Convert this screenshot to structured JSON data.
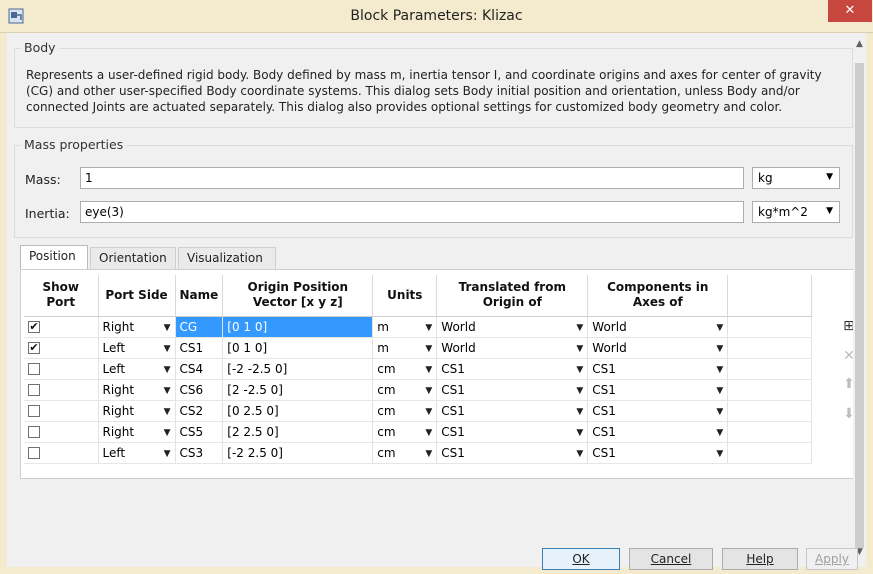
{
  "window": {
    "title": "Block Parameters: Klizac",
    "close_label": "✕"
  },
  "body_group": {
    "legend": "Body",
    "description": "Represents a user-defined rigid body. Body defined by mass m, inertia tensor I, and coordinate origins and axes for center of gravity (CG) and other user-specified Body coordinate systems. This dialog sets Body initial position and orientation, unless Body and/or connected Joints are actuated separately. This dialog also provides optional settings for customized body geometry and color."
  },
  "mass_group": {
    "legend": "Mass properties",
    "mass_label": "Mass:",
    "mass_value": "1",
    "mass_unit": "kg",
    "inertia_label": "Inertia:",
    "inertia_value": "eye(3)",
    "inertia_unit": "kg*m^2"
  },
  "tabs": [
    {
      "label": "Position"
    },
    {
      "label": "Orientation"
    },
    {
      "label": "Visualization"
    }
  ],
  "table": {
    "headers": {
      "show_port": "Show Port",
      "port_side": "Port Side",
      "name": "Name",
      "origin": "Origin Position Vector [x y z]",
      "units": "Units",
      "translated": "Translated from Origin of",
      "components": "Components in Axes of"
    },
    "rows": [
      {
        "show": "✔",
        "side": "Right",
        "name": "CG",
        "origin": "[0 1 0]",
        "units": "m",
        "translated": "World",
        "components": "World"
      },
      {
        "show": "✔",
        "side": "Left",
        "name": "CS1",
        "origin": "[0 1 0]",
        "units": "m",
        "translated": "World",
        "components": "World"
      },
      {
        "show": "",
        "side": "Left",
        "name": "CS4",
        "origin": "[-2 -2.5 0]",
        "units": "cm",
        "translated": "CS1",
        "components": "CS1"
      },
      {
        "show": "",
        "side": "Right",
        "name": "CS6",
        "origin": "[2 -2.5 0]",
        "units": "cm",
        "translated": "CS1",
        "components": "CS1"
      },
      {
        "show": "",
        "side": "Right",
        "name": "CS2",
        "origin": "[0 2.5 0]",
        "units": "cm",
        "translated": "CS1",
        "components": "CS1"
      },
      {
        "show": "",
        "side": "Right",
        "name": "CS5",
        "origin": "[2 2.5 0]",
        "units": "cm",
        "translated": "CS1",
        "components": "CS1"
      },
      {
        "show": "",
        "side": "Left",
        "name": "CS3",
        "origin": "[-2 2.5 0]",
        "units": "cm",
        "translated": "CS1",
        "components": "CS1"
      }
    ]
  },
  "side_buttons": {
    "add": "⊞",
    "delete": "✕",
    "up": "⬆",
    "down": "⬇"
  },
  "buttons": {
    "ok": "OK",
    "cancel": "Cancel",
    "help": "Help",
    "apply": "Apply"
  }
}
